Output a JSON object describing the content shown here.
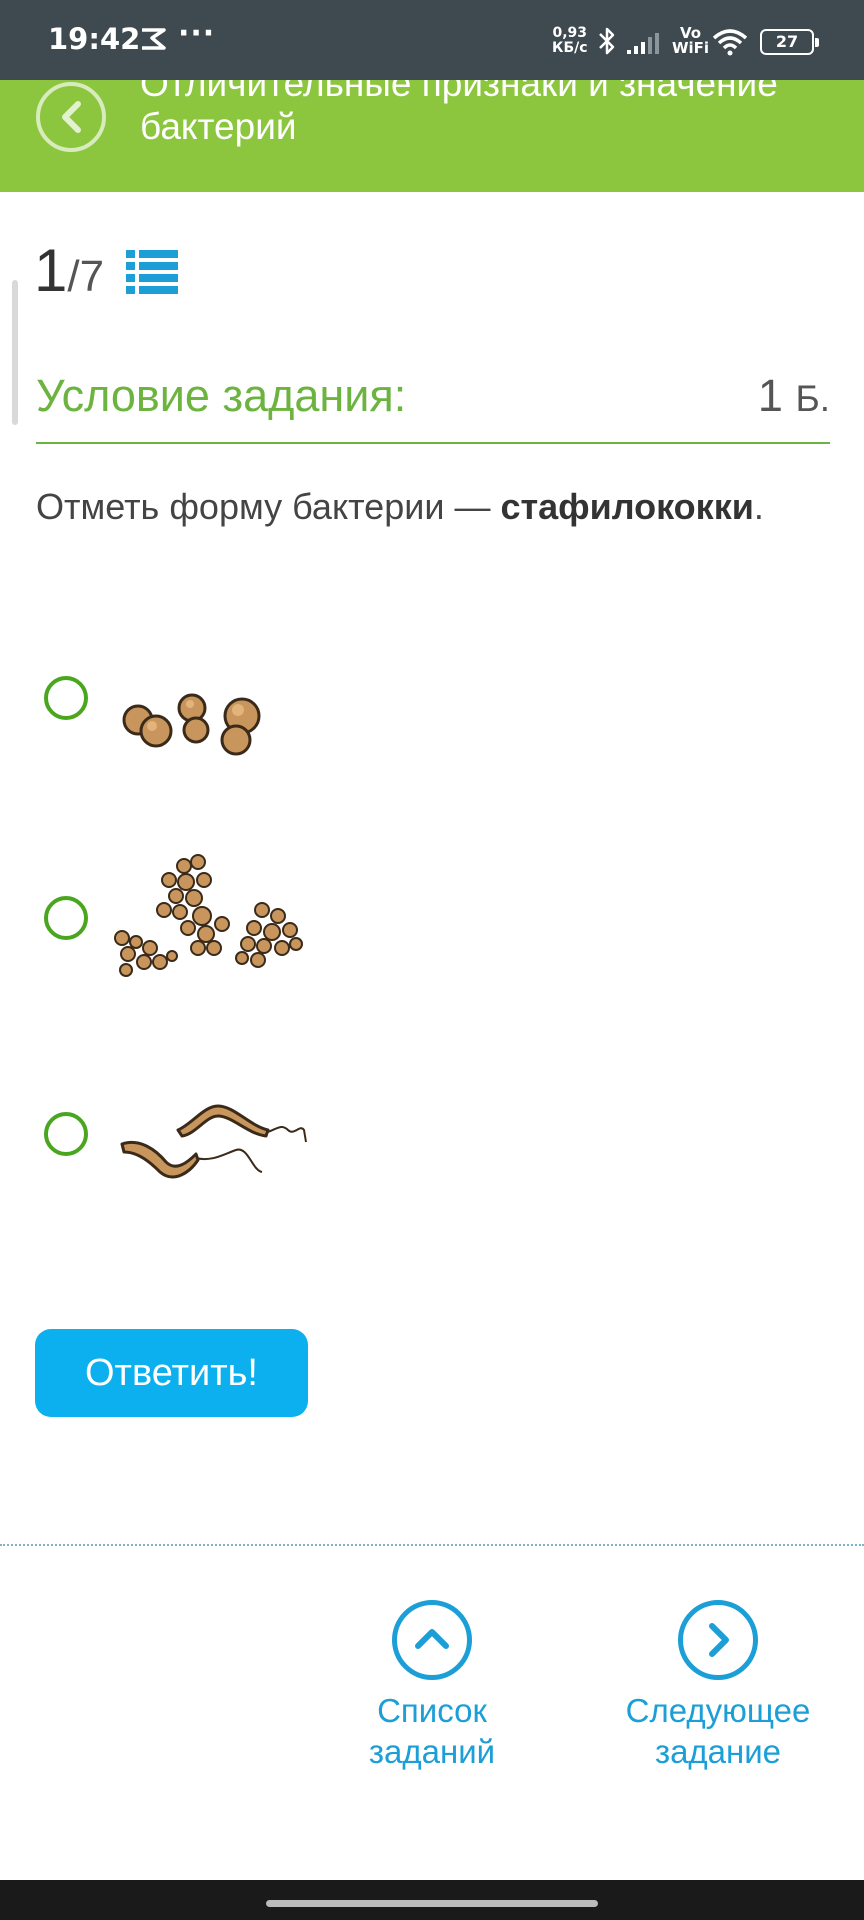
{
  "status_bar": {
    "time": "19:42",
    "dots": "···",
    "speed_value": "0,93",
    "speed_unit": "КБ/с",
    "vowifi_line1": "Vo",
    "vowifi_line2": "WiFi",
    "battery": "27"
  },
  "header": {
    "title": "Отличительные признаки и значение бактерий",
    "back_icon": "chevron-left-icon"
  },
  "progress": {
    "current": "1",
    "separator": "/",
    "total": "7",
    "list_icon": "list-icon"
  },
  "task": {
    "condition_label": "Условие задания:",
    "points_value": "1",
    "points_unit": "Б.",
    "question_prefix": "Отметь форму бактерии — ",
    "question_bold": "стафилококки",
    "question_suffix": "."
  },
  "options": [
    {
      "image": "diplococci-image",
      "selected": false
    },
    {
      "image": "staphylococci-image",
      "selected": false
    },
    {
      "image": "spirilla-image",
      "selected": false
    }
  ],
  "answer_button": {
    "label": "Ответить!"
  },
  "footer": {
    "task_list_line1": "Список",
    "task_list_line2": "заданий",
    "next_task_line1": "Следующее",
    "next_task_line2": "задание"
  },
  "colors": {
    "header_green": "#8cc63f",
    "accent_green": "#6cb33f",
    "radio_green": "#4aa51f",
    "button_blue": "#0db0ef",
    "link_blue": "#1b9fd6",
    "status_bar": "#3e4a50"
  }
}
